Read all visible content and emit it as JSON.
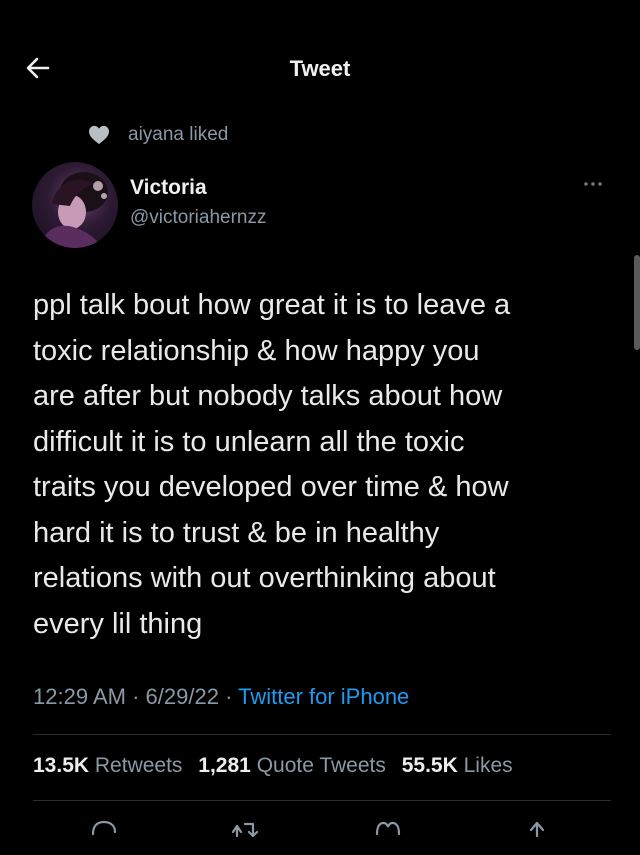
{
  "header": {
    "title": "Tweet",
    "back_icon": "arrow-left-icon"
  },
  "social_context": {
    "text": "aiyana liked",
    "icon": "heart-icon"
  },
  "author": {
    "name": "Victoria",
    "handle": "@victoriahernzz",
    "more_icon": "more-horizontal-icon"
  },
  "tweet": {
    "text_lines": [
      "ppl talk bout how great it is to leave a",
      "toxic relationship & how happy you",
      "are after but nobody talks about how",
      "difficult it is to unlearn all the toxic",
      "traits you developed over time & how",
      "hard it is to trust & be in healthy",
      "relations with out overthinking about",
      "every lil thing"
    ],
    "time": "12:29 AM",
    "date": "6/29/22",
    "source": "Twitter for iPhone",
    "separator": "·"
  },
  "stats": {
    "retweets_count": "13.5K",
    "retweets_label": "Retweets",
    "quotes_count": "1,281",
    "quotes_label": "Quote Tweets",
    "likes_count": "55.5K",
    "likes_label": "Likes"
  },
  "actions": [
    "reply-icon",
    "retweet-icon",
    "like-icon",
    "share-icon"
  ],
  "colors": {
    "background": "#000000",
    "text_primary": "#e7e9ea",
    "text_secondary": "#8b98a5",
    "link": "#1d9bf0",
    "divider": "#2a2d31"
  }
}
